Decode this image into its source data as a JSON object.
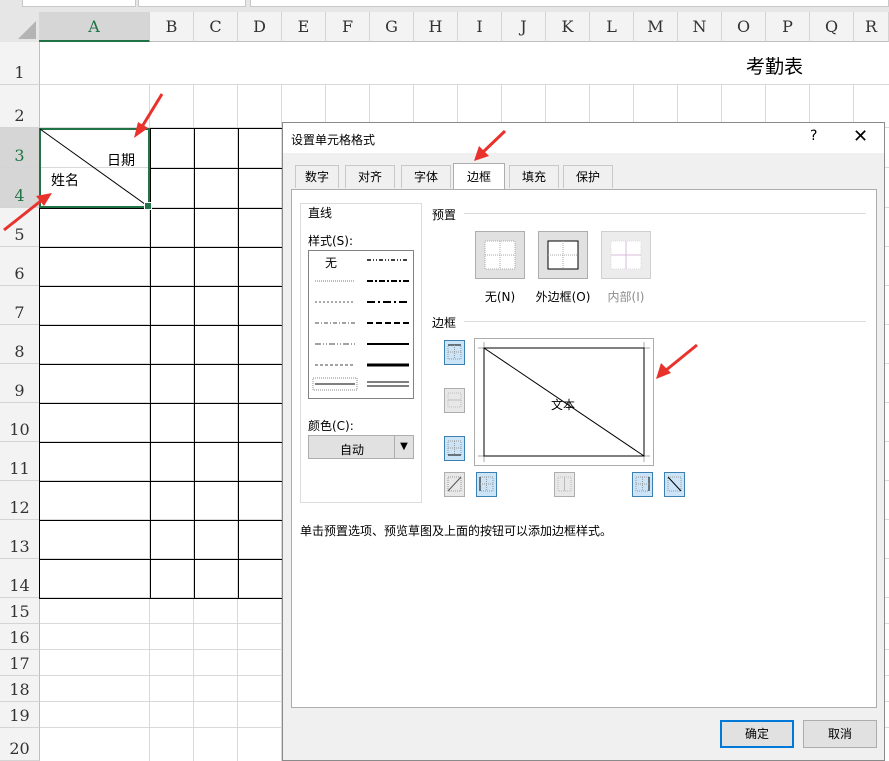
{
  "spreadsheet": {
    "columns": [
      "A",
      "B",
      "C",
      "D",
      "E",
      "F",
      "G",
      "H",
      "I",
      "J",
      "K",
      "L",
      "M",
      "N",
      "O",
      "P",
      "Q",
      "R"
    ],
    "rows": [
      "1",
      "2",
      "3",
      "4",
      "5",
      "6",
      "7",
      "8",
      "9",
      "10",
      "11",
      "12",
      "13",
      "14",
      "15",
      "16",
      "17",
      "18",
      "19",
      "20"
    ],
    "selected_column": "A",
    "title_cell": "考勤表",
    "cell_a3_top_right": "日期",
    "cell_a3_bottom_left": "姓名"
  },
  "dialog": {
    "title": "设置单元格格式",
    "help_label": "?",
    "close_label": "✕",
    "tabs": [
      "数字",
      "对齐",
      "字体",
      "边框",
      "填充",
      "保护"
    ],
    "active_tab": "边框",
    "line_group_label": "直线",
    "style_label": "样式(S):",
    "style_none_label": "无",
    "color_label": "颜色(C):",
    "color_value": "自动",
    "preset_label": "预置",
    "presets": [
      "无(N)",
      "外边框(O)",
      "内部(I)"
    ],
    "border_label": "边框",
    "preview_text": "文本",
    "hint_text": "单击预置选项、预览草图及上面的按钮可以添加边框样式。",
    "ok_label": "确定",
    "cancel_label": "取消"
  },
  "colors": {
    "accent_green": "#217346",
    "arrow_red": "#e8322b",
    "primary_blue": "#0078d7"
  }
}
